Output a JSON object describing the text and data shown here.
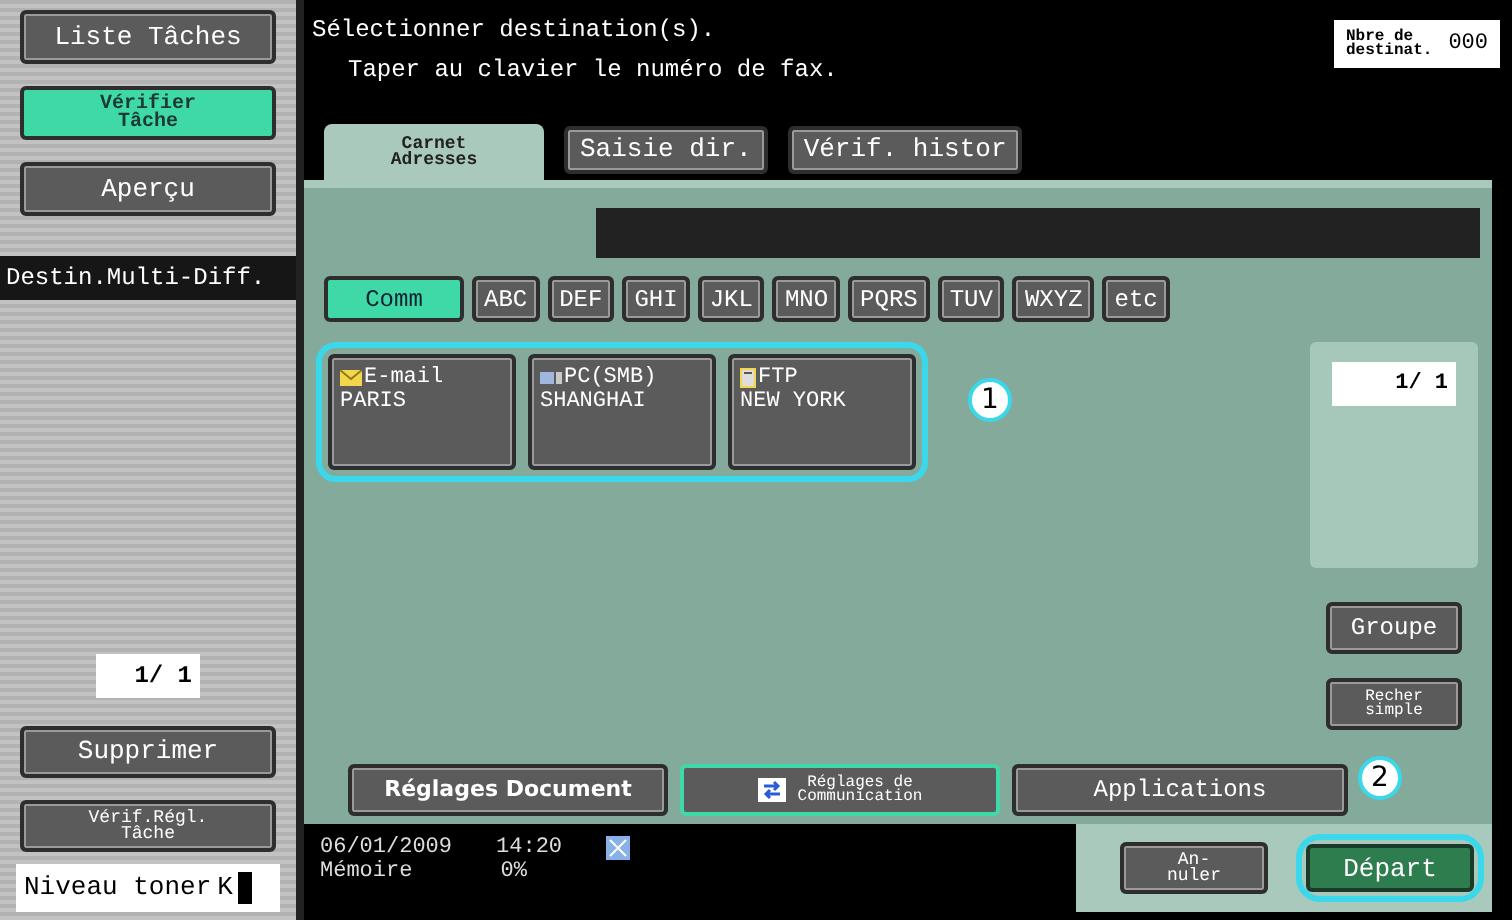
{
  "sidebar": {
    "buttons": [
      {
        "label": "Liste Tâches",
        "selected": false
      },
      {
        "label": "Vérifier\nTâche",
        "selected": true
      },
      {
        "label": "Aperçu",
        "selected": false
      }
    ],
    "section_label": "Destin.Multi-Diff.",
    "page": "1/ 1",
    "actions": [
      "Supprimer",
      "Vérif.Régl.\nTâche"
    ],
    "toner": {
      "label": "Niveau toner",
      "channel": "K"
    }
  },
  "header": {
    "title": "Sélectionner destination(s).",
    "subtitle": "Taper au clavier le numéro de fax.",
    "count_label": "Nbre de\ndestinat.",
    "count": "000"
  },
  "tabs": [
    {
      "label": "Carnet\nAdresses",
      "selected": true
    },
    {
      "label": "Saisie dir.",
      "selected": false
    },
    {
      "label": "Vérif. histor",
      "selected": false
    }
  ],
  "index_tabs": [
    {
      "label": "Comm",
      "selected": true
    },
    {
      "label": "ABC",
      "selected": false
    },
    {
      "label": "DEF",
      "selected": false
    },
    {
      "label": "GHI",
      "selected": false
    },
    {
      "label": "JKL",
      "selected": false
    },
    {
      "label": "MNO",
      "selected": false
    },
    {
      "label": "PQRS",
      "selected": false
    },
    {
      "label": "TUV",
      "selected": false
    },
    {
      "label": "WXYZ",
      "selected": false
    },
    {
      "label": "etc",
      "selected": false
    }
  ],
  "destinations": [
    {
      "kind": "email",
      "type": "E-mail",
      "name": "PARIS"
    },
    {
      "kind": "pc",
      "type": "PC(SMB)",
      "name": "SHANGHAI"
    },
    {
      "kind": "ftp",
      "type": "FTP",
      "name": "NEW YORK"
    }
  ],
  "page": "1/ 1",
  "side_buttons": [
    "Groupe",
    "Recher\nsimple"
  ],
  "bottom_buttons": [
    {
      "label": "Réglages Document",
      "selected": false
    },
    {
      "label": "Réglages de\nCommunication",
      "selected": true
    },
    {
      "label": "Applications",
      "selected": false
    }
  ],
  "footer": {
    "date": "06/01/2009",
    "time": "14:20",
    "memory_label": "Mémoire",
    "memory": "0%"
  },
  "actions": [
    {
      "kind": "cancel",
      "label": "An-\nnuler"
    },
    {
      "kind": "start",
      "label": "Départ"
    }
  ],
  "callouts": [
    "1",
    "2"
  ]
}
